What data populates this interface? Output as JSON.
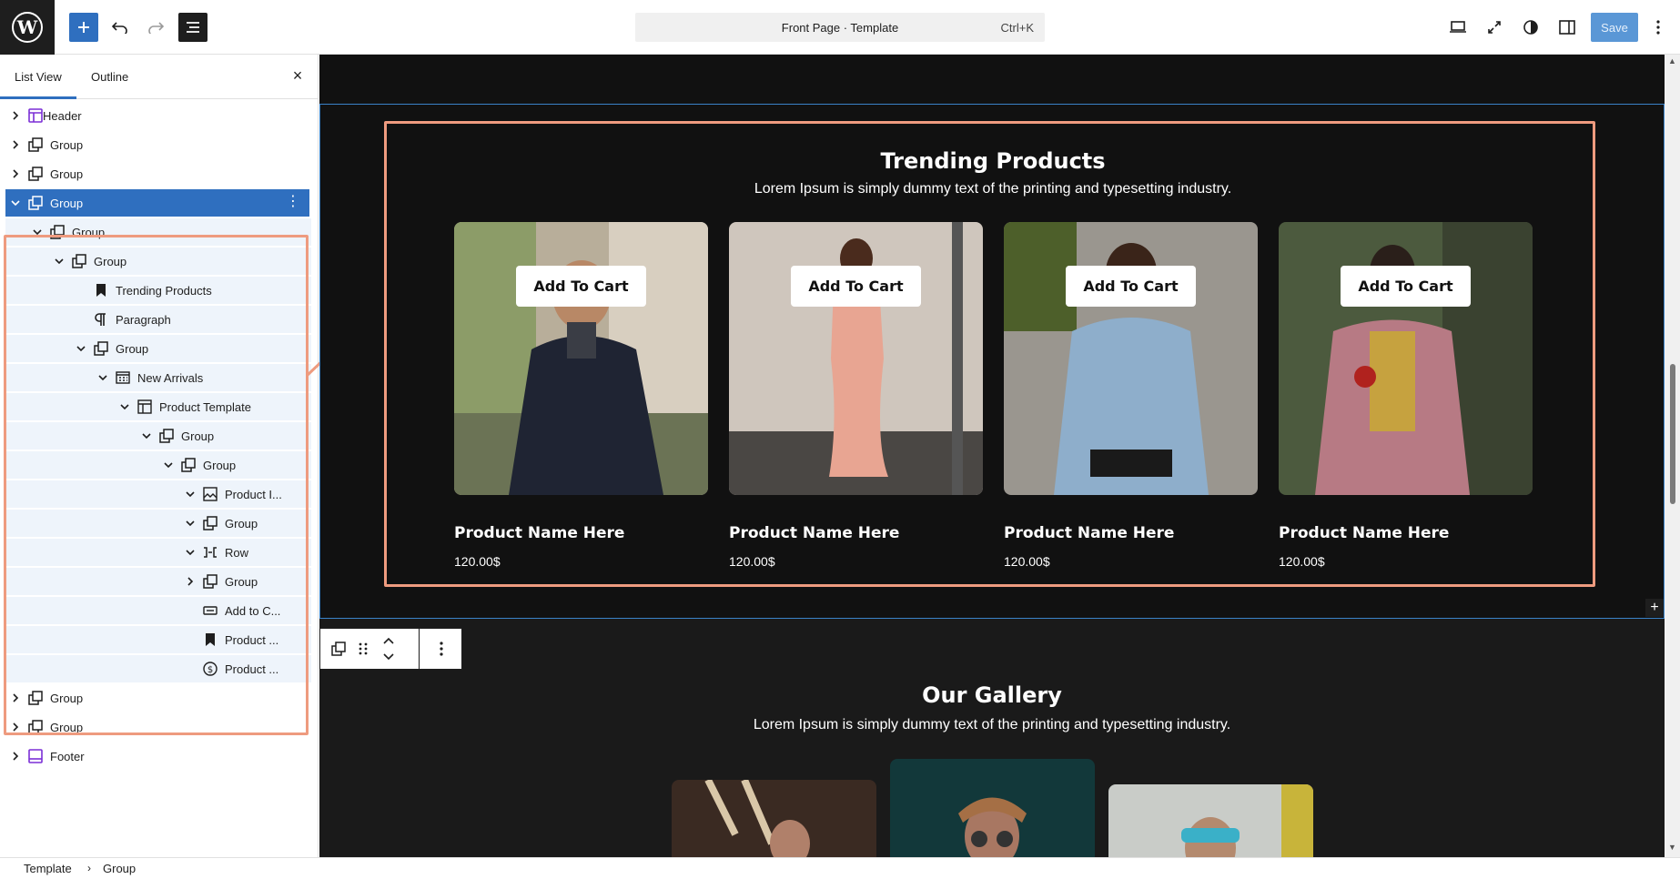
{
  "header": {
    "doc_title": "Front Page · Template",
    "shortcut": "Ctrl+K",
    "save_label": "Save"
  },
  "sidebar": {
    "tab_list_view": "List View",
    "tab_outline": "Outline",
    "close": "×",
    "items": [
      {
        "label": "Header"
      },
      {
        "label": "Group"
      },
      {
        "label": "Group"
      },
      {
        "label": "Group"
      },
      {
        "label": "Group"
      },
      {
        "label": "Group"
      },
      {
        "label": "Trending Products"
      },
      {
        "label": "Paragraph"
      },
      {
        "label": "Group"
      },
      {
        "label": "New Arrivals"
      },
      {
        "label": "Product Template"
      },
      {
        "label": "Group"
      },
      {
        "label": "Group"
      },
      {
        "label": "Product I..."
      },
      {
        "label": "Group"
      },
      {
        "label": "Row"
      },
      {
        "label": "Group"
      },
      {
        "label": "Add to C..."
      },
      {
        "label": "Product ..."
      },
      {
        "label": "Product ..."
      },
      {
        "label": "Group"
      },
      {
        "label": "Group"
      },
      {
        "label": "Footer"
      }
    ]
  },
  "canvas": {
    "trending_title": "Trending Products",
    "trending_sub": "Lorem Ipsum is simply dummy text of the printing and typesetting industry.",
    "products": [
      {
        "button": "Add To Cart",
        "name": "Product Name Here",
        "price": "120.00$"
      },
      {
        "button": "Add To Cart",
        "name": "Product Name Here",
        "price": "120.00$"
      },
      {
        "button": "Add To Cart",
        "name": "Product Name Here",
        "price": "120.00$"
      },
      {
        "button": "Add To Cart",
        "name": "Product Name Here",
        "price": "120.00$"
      }
    ],
    "gallery_title": "Our Gallery",
    "gallery_sub": "Lorem Ipsum is simply dummy text of the printing and typesetting industry.",
    "insert": "+"
  },
  "breadcrumb": {
    "root": "Template",
    "current": "Group"
  },
  "colors": {
    "accent": "#2f6fbf",
    "highlight": "#ee9b7f",
    "canvas_bg": "#111111"
  }
}
